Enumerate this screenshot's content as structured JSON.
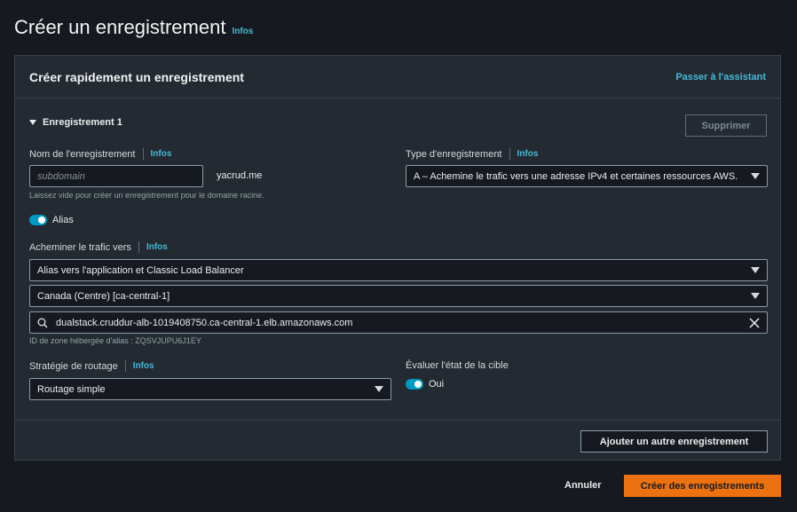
{
  "page": {
    "title": "Créer un enregistrement",
    "info": "Infos"
  },
  "panel": {
    "title": "Créer rapidement un enregistrement",
    "wizard_link": "Passer à l'assistant"
  },
  "record": {
    "section_title": "Enregistrement 1",
    "delete_label": "Supprimer",
    "name": {
      "label": "Nom de l'enregistrement",
      "info": "Infos",
      "placeholder": "subdomain",
      "value": "",
      "domain_suffix": "yacrud.me",
      "hint": "Laissez vide pour créer un enregistrement pour le domaine racine."
    },
    "type": {
      "label": "Type d'enregistrement",
      "info": "Infos",
      "value": "A – Achemine le trafic vers une adresse IPv4 et certaines ressources AWS."
    },
    "alias": {
      "label": "Alias",
      "enabled": true
    },
    "route": {
      "label": "Acheminer le trafic vers",
      "info": "Infos",
      "endpoint": "Alias vers l'application et Classic Load Balancer",
      "region": "Canada (Centre) [ca-central-1]",
      "target": "dualstack.cruddur-alb-1019408750.ca-central-1.elb.amazonaws.com",
      "zone_hint": "ID de zone hébergée d'alias : ZQSVJUPU6J1EY"
    },
    "routing_policy": {
      "label": "Stratégie de routage",
      "info": "Infos",
      "value": "Routage simple"
    },
    "health": {
      "label": "Évaluer l'état de la cible",
      "value": "Oui",
      "enabled": true
    }
  },
  "add_record_label": "Ajouter un autre enregistrement",
  "footer": {
    "cancel": "Annuler",
    "submit": "Créer des enregistrements"
  },
  "colors": {
    "accent": "#ec7211",
    "link": "#44b9d6",
    "toggle": "#0099c1"
  },
  "icons": [
    "triangle-down-icon",
    "search-icon",
    "clear-icon",
    "caret-down-icon"
  ]
}
